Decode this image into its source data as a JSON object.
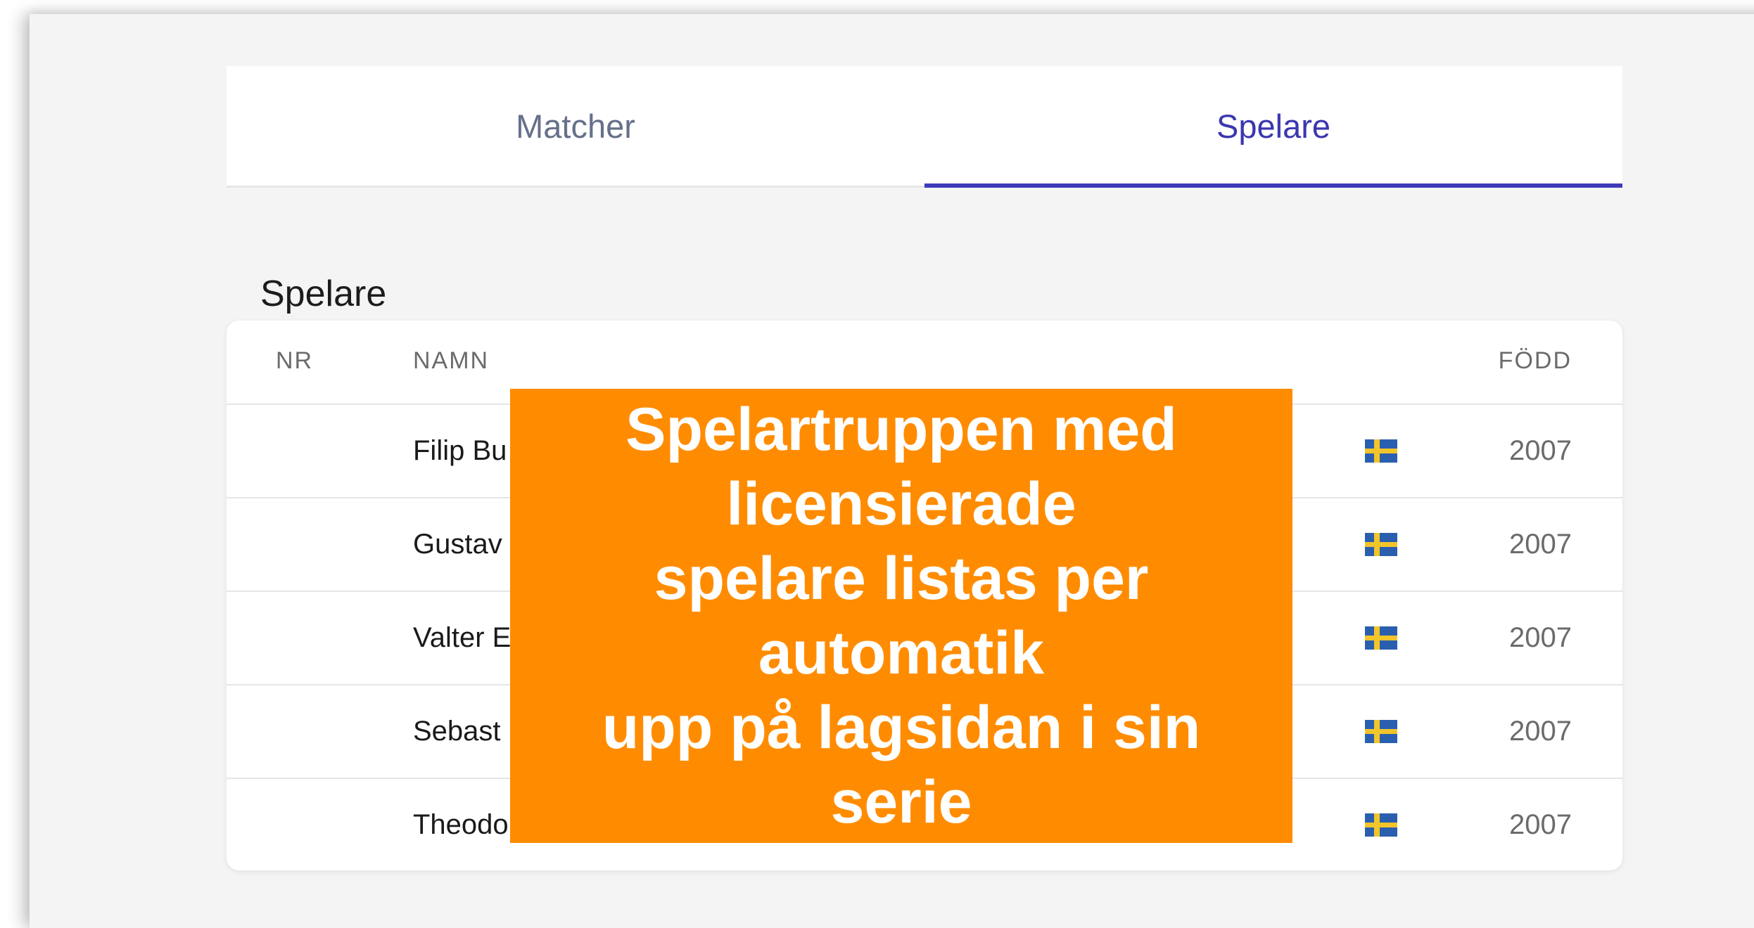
{
  "tabs": [
    {
      "label": "Matcher",
      "active": false
    },
    {
      "label": "Spelare",
      "active": true
    }
  ],
  "section_title": "Spelare",
  "table": {
    "columns": {
      "nr": "NR",
      "name": "NAMN",
      "born": "FÖDD"
    },
    "rows": [
      {
        "nr": "",
        "name": "Filip Bu",
        "flag": "swedish-flag",
        "born": "2007"
      },
      {
        "nr": "",
        "name": "Gustav",
        "flag": "swedish-flag",
        "born": "2007"
      },
      {
        "nr": "",
        "name": "Valter E",
        "flag": "swedish-flag",
        "born": "2007"
      },
      {
        "nr": "",
        "name": "Sebast",
        "flag": "swedish-flag",
        "born": "2007"
      },
      {
        "nr": "",
        "name": "Theodo",
        "flag": "swedish-flag",
        "born": "2007"
      }
    ]
  },
  "overlay": {
    "text": "Spelartruppen med\nlicensierade\nspelare listas per\nautomatik\nupp på lagsidan i sin\nserie",
    "color": "#ff8c00"
  },
  "colors": {
    "accent": "#3e3bb8",
    "flag_blue": "#2a5fb0",
    "flag_yellow": "#f2c52a"
  }
}
